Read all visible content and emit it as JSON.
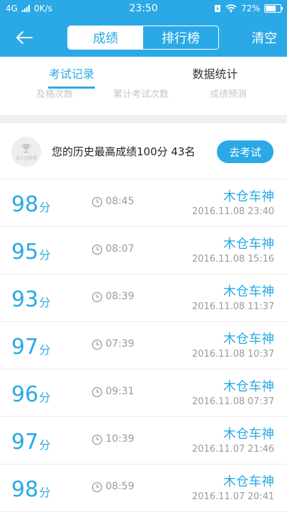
{
  "status_bar": {
    "network": "4G",
    "speed": "0K/s",
    "time": "23:50",
    "battery": "72%"
  },
  "header": {
    "segments": [
      "成绩",
      "排行榜"
    ],
    "clear_label": "清空"
  },
  "tabs": [
    "考试记录",
    "数据统计"
  ],
  "stats_labels": [
    "及格次数",
    "累计考试次数",
    "成绩预测"
  ],
  "summary": {
    "trophy_text": "达人已获得",
    "text": "您的历史最高成绩100分  43名",
    "button": "去考试"
  },
  "records": [
    {
      "score": "98",
      "unit": "分",
      "duration": "08:45",
      "name": "木仓车神",
      "date": "2016.11.08  23:40"
    },
    {
      "score": "95",
      "unit": "分",
      "duration": "08:07",
      "name": "木仓车神",
      "date": "2016.11.08  15:16"
    },
    {
      "score": "93",
      "unit": "分",
      "duration": "08:39",
      "name": "木仓车神",
      "date": "2016.11.08  11:37"
    },
    {
      "score": "97",
      "unit": "分",
      "duration": "07:39",
      "name": "木仓车神",
      "date": "2016.11.08  10:37"
    },
    {
      "score": "96",
      "unit": "分",
      "duration": "09:31",
      "name": "木仓车神",
      "date": "2016.11.08  07:37"
    },
    {
      "score": "97",
      "unit": "分",
      "duration": "10:39",
      "name": "木仓车神",
      "date": "2016.11.07  21:46"
    },
    {
      "score": "98",
      "unit": "分",
      "duration": "08:59",
      "name": "木仓车神",
      "date": "2016.11.07  20:41"
    }
  ],
  "colors": {
    "accent": "#2aa9e6",
    "text_dark": "#222222",
    "text_muted": "#9a9a9a"
  }
}
